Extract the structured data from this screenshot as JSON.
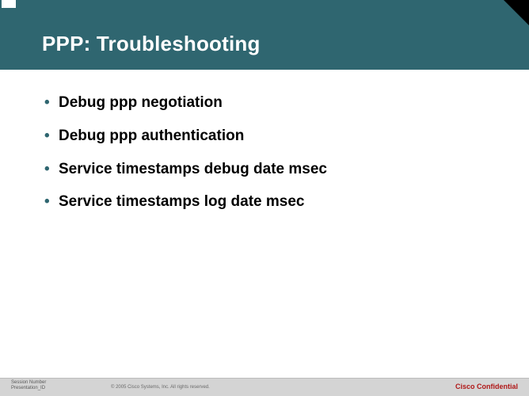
{
  "header": {
    "title": "PPP: Troubleshooting"
  },
  "bullets": [
    "Debug ppp negotiation",
    "Debug ppp authentication",
    "Service timestamps debug date msec",
    "Service timestamps log date msec"
  ],
  "footer": {
    "session_line1": "Session Number",
    "session_line2": "Presentation_ID",
    "copyright": "© 2005 Cisco Systems, Inc. All rights reserved.",
    "confidential": "Cisco Confidential"
  }
}
